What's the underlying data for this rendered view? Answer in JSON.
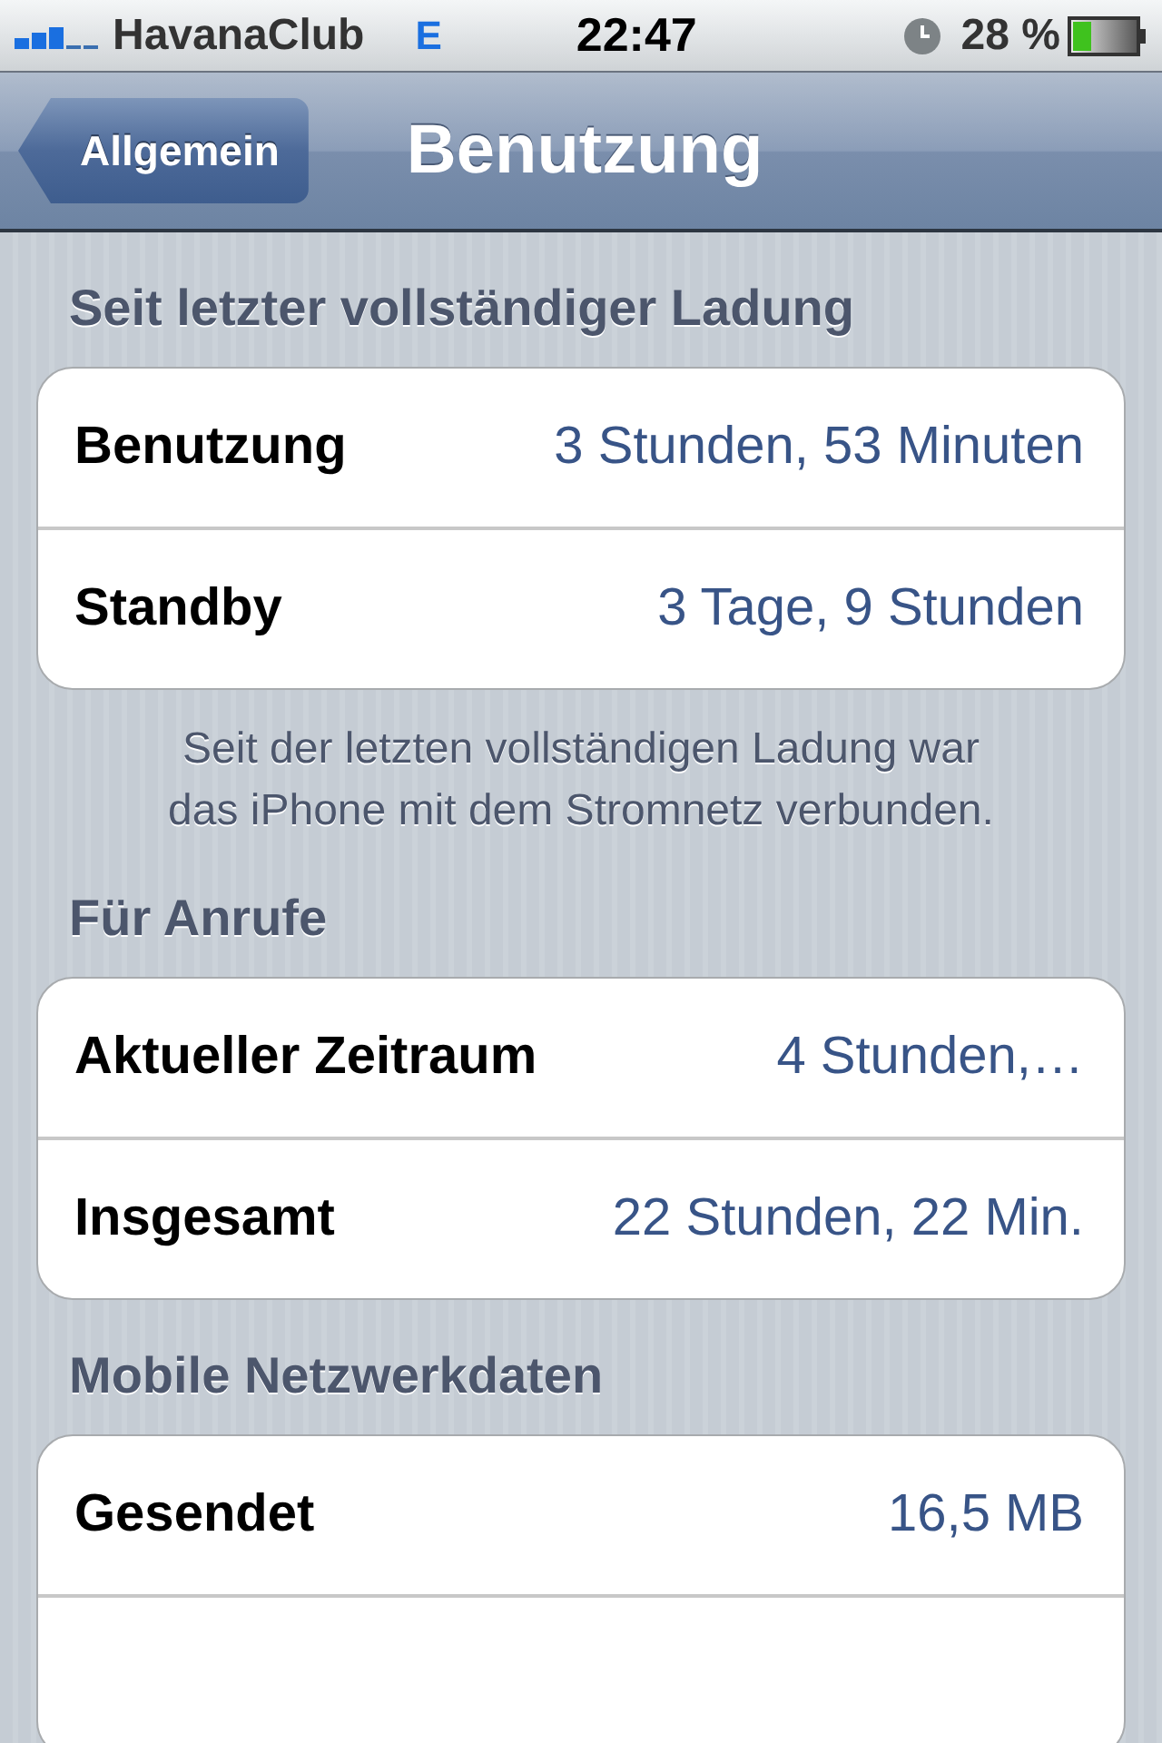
{
  "status_bar": {
    "carrier": "HavanaClub",
    "network": "E",
    "time": "22:47",
    "battery": "28 %"
  },
  "nav": {
    "back": "Allgemein",
    "title": "Benutzung"
  },
  "sections": [
    {
      "header": "Seit letzter vollständiger Ladung",
      "rows": [
        {
          "kind": "value",
          "label": "Benutzung",
          "value": "3 Stunden, 53 Minuten"
        },
        {
          "kind": "value",
          "label": "Standby",
          "value": "3 Tage, 9 Stunden"
        }
      ],
      "footer": "Seit der letzten vollständigen Ladung war das iPhone mit dem Stromnetz verbunden."
    },
    {
      "header": "Für Anrufe",
      "rows": [
        {
          "kind": "value",
          "label": "Aktueller Zeitraum",
          "value": "4 Stunden,…"
        },
        {
          "kind": "value",
          "label": "Insgesamt",
          "value": "22 Stunden, 22 Min."
        }
      ]
    },
    {
      "header": "Mobile Netzwerkdaten",
      "rows": [
        {
          "kind": "value",
          "label": "Gesendet",
          "value": "16,5 MB"
        },
        {
          "kind": "blank"
        }
      ]
    }
  ]
}
